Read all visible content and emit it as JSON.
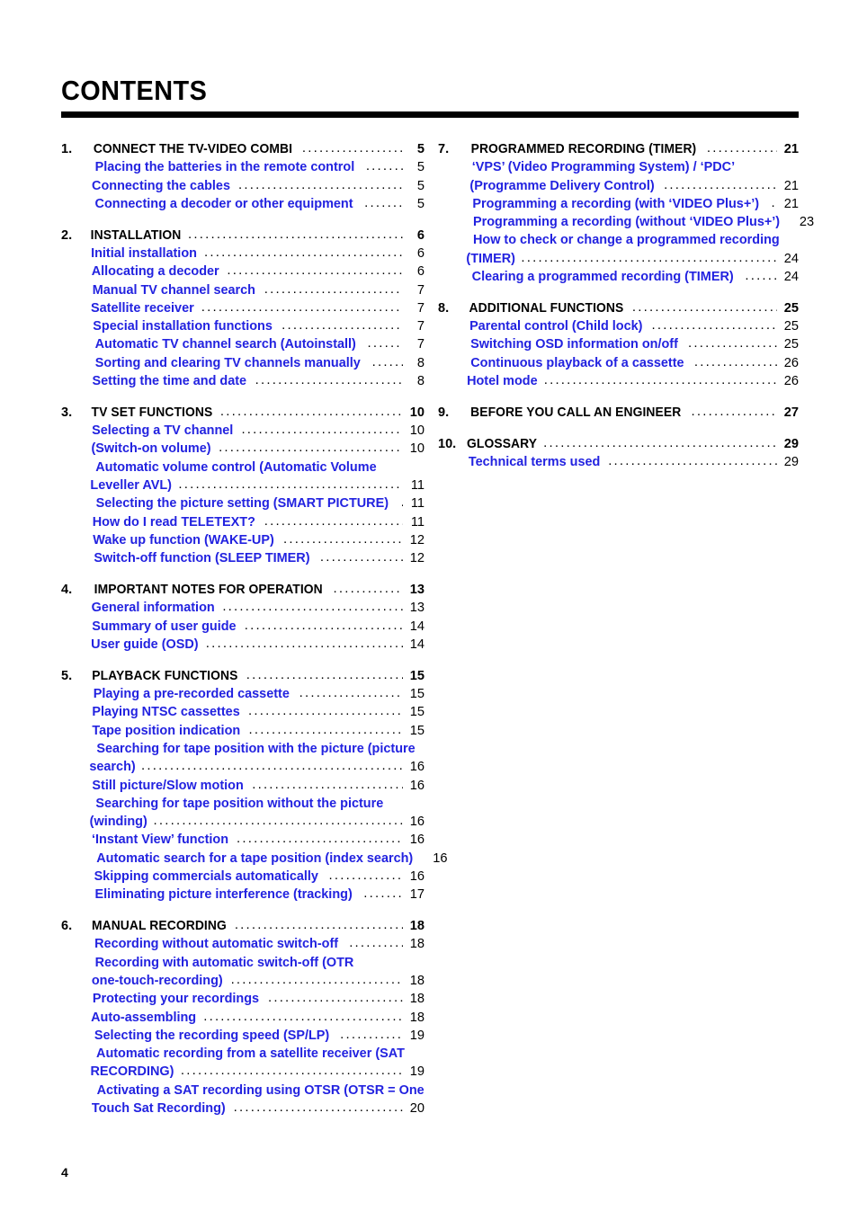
{
  "page": {
    "title": "CONTENTS",
    "folio": "4",
    "accent_color": "#2222e0",
    "rule_color": "#000000"
  },
  "columns": {
    "left": [
      {
        "number": "1.",
        "title": "CONNECT THE TV-VIDEO COMBI",
        "page": "5",
        "entries": [
          {
            "lines": [
              "Placing the batteries in the remote control"
            ],
            "page": "5"
          },
          {
            "lines": [
              "Connecting the cables"
            ],
            "page": "5"
          },
          {
            "lines": [
              "Connecting a decoder or other equipment"
            ],
            "page": "5"
          }
        ]
      },
      {
        "number": "2.",
        "title": "INSTALLATION",
        "page": "6",
        "entries": [
          {
            "lines": [
              "Initial installation"
            ],
            "page": "6"
          },
          {
            "lines": [
              "Allocating a decoder"
            ],
            "page": "6"
          },
          {
            "lines": [
              "Manual TV channel search"
            ],
            "page": "7"
          },
          {
            "lines": [
              "Satellite receiver"
            ],
            "page": "7"
          },
          {
            "lines": [
              "Special installation functions"
            ],
            "page": "7"
          },
          {
            "lines": [
              "Automatic TV channel search (Autoinstall)"
            ],
            "page": "7"
          },
          {
            "lines": [
              "Sorting and clearing TV channels manually"
            ],
            "page": "8"
          },
          {
            "lines": [
              "Setting the time and date"
            ],
            "page": "8"
          }
        ]
      },
      {
        "number": "3.",
        "title": "TV SET FUNCTIONS",
        "page": "10",
        "entries": [
          {
            "lines": [
              "Selecting a TV channel"
            ],
            "page": "10"
          },
          {
            "lines": [
              "(Switch-on volume)"
            ],
            "page": "10"
          },
          {
            "lines": [
              "Automatic volume control (Automatic Volume",
              "Leveller AVL)"
            ],
            "page": "11"
          },
          {
            "lines": [
              "Selecting the picture setting (SMART PICTURE)"
            ],
            "page": "11"
          },
          {
            "lines": [
              "How do I read TELETEXT?"
            ],
            "page": "11"
          },
          {
            "lines": [
              "Wake up function (WAKE-UP)"
            ],
            "page": "12"
          },
          {
            "lines": [
              "Switch-off function (SLEEP TIMER)"
            ],
            "page": "12"
          }
        ]
      },
      {
        "number": "4.",
        "title": "IMPORTANT NOTES FOR OPERATION",
        "page": "13",
        "entries": [
          {
            "lines": [
              "General information"
            ],
            "page": "13"
          },
          {
            "lines": [
              "Summary of user guide"
            ],
            "page": "14"
          },
          {
            "lines": [
              "User guide (OSD)"
            ],
            "page": "14"
          }
        ]
      },
      {
        "number": "5.",
        "title": "PLAYBACK FUNCTIONS",
        "page": "15",
        "entries": [
          {
            "lines": [
              "Playing a pre-recorded cassette"
            ],
            "page": "15"
          },
          {
            "lines": [
              "Playing NTSC cassettes"
            ],
            "page": "15"
          },
          {
            "lines": [
              "Tape position indication"
            ],
            "page": "15"
          },
          {
            "lines": [
              "Searching for tape position with the picture (picture",
              "search)"
            ],
            "page": "16"
          },
          {
            "lines": [
              "Still picture/Slow motion"
            ],
            "page": "16"
          },
          {
            "lines": [
              "Searching for tape position without the picture",
              "(winding)"
            ],
            "page": "16"
          },
          {
            "lines": [
              "‘Instant View’ function"
            ],
            "page": "16"
          },
          {
            "lines": [
              "Automatic search for a tape position (index search)"
            ],
            "page": "16"
          },
          {
            "lines": [
              "Skipping commercials automatically"
            ],
            "page": "16"
          },
          {
            "lines": [
              "Eliminating picture interference (tracking)"
            ],
            "page": "17"
          }
        ]
      },
      {
        "number": "6.",
        "title": "MANUAL RECORDING",
        "page": "18",
        "entries": [
          {
            "lines": [
              "Recording without automatic switch-off"
            ],
            "page": "18"
          },
          {
            "lines": [
              "Recording with automatic switch-off (OTR",
              "one-touch-recording)"
            ],
            "page": "18"
          },
          {
            "lines": [
              "Protecting your recordings"
            ],
            "page": "18"
          },
          {
            "lines": [
              "Auto-assembling"
            ],
            "page": "18"
          },
          {
            "lines": [
              "Selecting the recording speed (SP/LP)"
            ],
            "page": "19"
          },
          {
            "lines": [
              "Automatic recording from a satellite receiver (SAT",
              "RECORDING)"
            ],
            "page": "19"
          },
          {
            "lines": [
              "Activating a SAT recording using OTSR (OTSR = One",
              "Touch Sat Recording)"
            ],
            "page": "20"
          }
        ]
      }
    ],
    "right": [
      {
        "number": "7.",
        "title": "PROGRAMMED RECORDING (TIMER)",
        "page": "21",
        "entries": [
          {
            "lines": [
              "‘VPS’ (Video Programming System) / ‘PDC’",
              "(Programme Delivery Control)"
            ],
            "page": "21"
          },
          {
            "lines": [
              "Programming a recording (with ‘VIDEO Plus+’)"
            ],
            "page": "21"
          },
          {
            "lines": [
              "Programming a recording (without ‘VIDEO Plus+’)"
            ],
            "page": "23"
          },
          {
            "lines": [
              "How to check or change a programmed recording",
              "(TIMER)"
            ],
            "page": "24"
          },
          {
            "lines": [
              "Clearing a programmed recording (TIMER)"
            ],
            "page": "24"
          }
        ]
      },
      {
        "number": "8.",
        "title": "ADDITIONAL FUNCTIONS",
        "page": "25",
        "entries": [
          {
            "lines": [
              "Parental control (Child lock)"
            ],
            "page": "25"
          },
          {
            "lines": [
              "Switching OSD information on/off"
            ],
            "page": "25"
          },
          {
            "lines": [
              "Continuous playback of a cassette"
            ],
            "page": "26"
          },
          {
            "lines": [
              "Hotel mode"
            ],
            "page": "26"
          }
        ]
      },
      {
        "number": "9.",
        "title": "BEFORE YOU CALL AN ENGINEER",
        "page": "27",
        "entries": []
      },
      {
        "number": "10.",
        "title": "GLOSSARY",
        "page": "29",
        "entries": [
          {
            "lines": [
              "Technical terms used"
            ],
            "page": "29"
          }
        ]
      }
    ]
  }
}
